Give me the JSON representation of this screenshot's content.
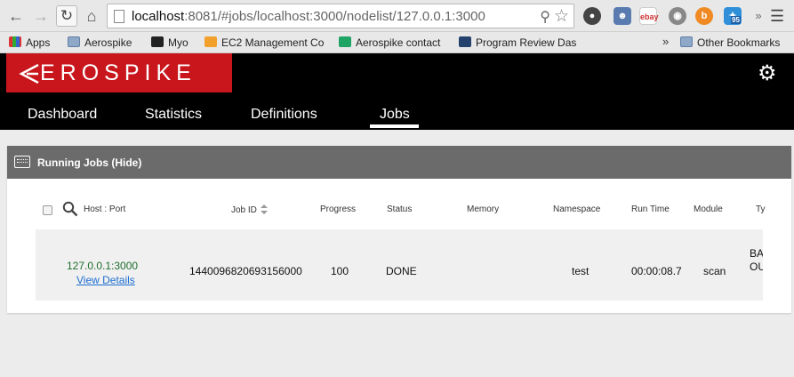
{
  "browser": {
    "url_host": "localhost",
    "url_rest": ":8081/#jobs/localhost:3000/nodelist/127.0.0.1:3000"
  },
  "bookmarks": {
    "items": [
      {
        "label": "Apps"
      },
      {
        "label": "Aerospike"
      },
      {
        "label": "Myo"
      },
      {
        "label": "EC2 Management Co"
      },
      {
        "label": "Aerospike contact"
      },
      {
        "label": "Program Review Das"
      }
    ],
    "more": "»",
    "other": "Other Bookmarks"
  },
  "extensions": {
    "twitter_badge": "95"
  },
  "app": {
    "logo_text": "EROSPIKE",
    "nav": [
      "Dashboard",
      "Statistics",
      "Definitions",
      "Jobs"
    ],
    "active_tab": "Jobs"
  },
  "panel": {
    "title": "Running Jobs (Hide)"
  },
  "table": {
    "headers": {
      "host_port": "Host : Port",
      "job_id": "Job ID",
      "progress": "Progress",
      "status": "Status",
      "memory": "Memory",
      "namespace": "Namespace",
      "run_time": "Run Time",
      "module": "Module",
      "type": "Ty"
    },
    "rows": [
      {
        "host": "127.0.0.1:3000",
        "details_link": "View Details",
        "job_id": "1440096820693156000",
        "progress": "100",
        "status": "DONE",
        "memory": "",
        "namespace": "test",
        "run_time": "00:00:08.7",
        "module": "scan",
        "type": "BA OU"
      }
    ]
  }
}
